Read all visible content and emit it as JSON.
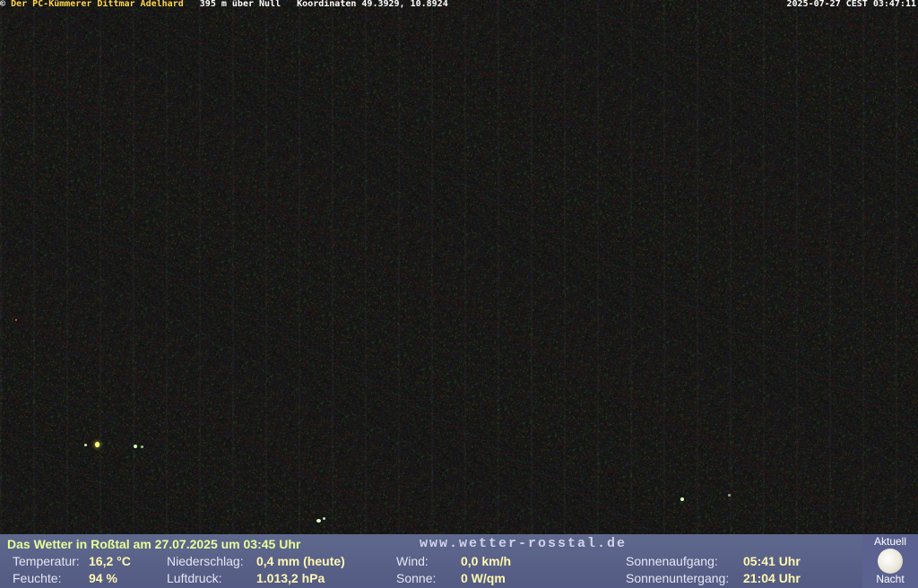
{
  "overlay": {
    "copyright_symbol": "©",
    "owner": "Der PC-Kümmerer Dittmar Adelhard",
    "altitude": "395 m über Null",
    "coordinates": "Koordinaten 49.3929, 10.8924",
    "timestamp": "2025-07-27 CEST 03:47:11"
  },
  "weather": {
    "title": "Das Wetter in Roßtal am 27.07.2025 um 03:45 Uhr",
    "website": "www.wetter-rosstal.de",
    "temperature_label": "Temperatur:",
    "temperature_value": "16,2 °C",
    "humidity_label": "Feuchte:",
    "humidity_value": "94 %",
    "precipitation_label": "Niederschlag:",
    "precipitation_value": "0,4 mm (heute)",
    "pressure_label": "Luftdruck:",
    "pressure_value": "1.013,2 hPa",
    "wind_label": "Wind:",
    "wind_value": "0,0 km/h",
    "sun_label": "Sonne:",
    "sun_value": "0 W/qm",
    "sunrise_label": "Sonnenaufgang:",
    "sunrise_value": "05:41 Uhr",
    "sunset_label": "Sonnenuntergang:",
    "sunset_value": "21:04 Uhr"
  },
  "moon": {
    "top_label": "Aktuell",
    "bottom_label": "Nacht",
    "icon": "moon-icon"
  },
  "colors": {
    "owner_text": "#ffd54a",
    "weather_title": "#e6ff99",
    "weather_values": "#fff8b0",
    "weather_bar": "#646e96"
  }
}
